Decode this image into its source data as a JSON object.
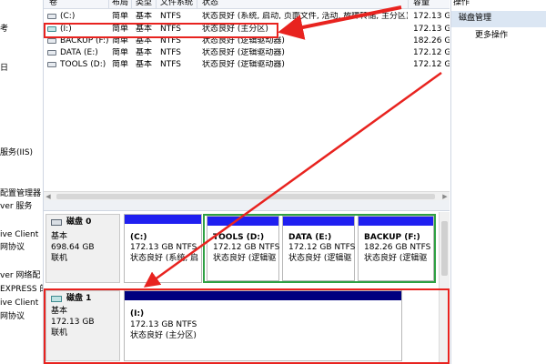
{
  "left_tree": [
    "考",
    "日",
    "服务(IIS)",
    "配置管理器",
    "ver 服务",
    "ive Client",
    "网协议",
    "ver 网络配",
    "EXPRESS 的",
    "ive Client",
    "网协议"
  ],
  "list_columns": [
    "卷",
    "布局",
    "类型",
    "文件系统",
    "状态",
    "容量"
  ],
  "volumes": [
    {
      "name": "(C:)",
      "layout": "简单",
      "type": "基本",
      "fs": "NTFS",
      "status": "状态良好 (系统, 启动, 页面文件, 活动, 故障转储, 主分区)",
      "capacity": "172.13 G",
      "icon": "drive-icon"
    },
    {
      "name": "(I:)",
      "layout": "简单",
      "type": "基本",
      "fs": "NTFS",
      "status": "状态良好 (主分区)",
      "capacity": "172.13 G",
      "icon": "drive-icon"
    },
    {
      "name": "BACKUP (F:)",
      "layout": "简单",
      "type": "基本",
      "fs": "NTFS",
      "status": "状态良好 (逻辑驱动器)",
      "capacity": "182.26 G",
      "icon": "drive-icon"
    },
    {
      "name": "DATA (E:)",
      "layout": "简单",
      "type": "基本",
      "fs": "NTFS",
      "status": "状态良好 (逻辑驱动器)",
      "capacity": "172.12 G",
      "icon": "drive-icon"
    },
    {
      "name": "TOOLS (D:)",
      "layout": "简单",
      "type": "基本",
      "fs": "NTFS",
      "status": "状态良好 (逻辑驱动器)",
      "capacity": "172.12 G",
      "icon": "drive-icon"
    }
  ],
  "disks": [
    {
      "name": "磁盘 0",
      "type": "基本",
      "size": "698.64 GB",
      "state": "联机",
      "icon": "disk-icon",
      "partitions": [
        {
          "name": "(C:)",
          "size": "172.13 GB NTFS",
          "status": "状态良好 (系统, 启"
        },
        {
          "name": "TOOLS  (D:)",
          "size": "172.12 GB NTFS",
          "status": "状态良好 (逻辑驱"
        },
        {
          "name": "DATA  (E:)",
          "size": "172.12 GB NTFS",
          "status": "状态良好 (逻辑驱"
        },
        {
          "name": "BACKUP  (F:)",
          "size": "182.26 GB NTFS",
          "status": "状态良好 (逻辑驱"
        }
      ]
    },
    {
      "name": "磁盘 1",
      "type": "基本",
      "size": "172.13 GB",
      "state": "联机",
      "icon": "disk-icon",
      "partitions": [
        {
          "name": "(I:)",
          "size": "172.13 GB NTFS",
          "status": "状态良好 (主分区)"
        }
      ]
    }
  ],
  "actions": {
    "title": "操作",
    "section": "磁盘管理",
    "more": "更多操作"
  },
  "colors": {
    "annotation_red": "#e8231f",
    "extended_partition_green": "#2ea043",
    "primary_bar_blue": "#1f1ff0",
    "disk1_bar_navy": "#00007f",
    "selection_blue": "#dbe6f3"
  }
}
